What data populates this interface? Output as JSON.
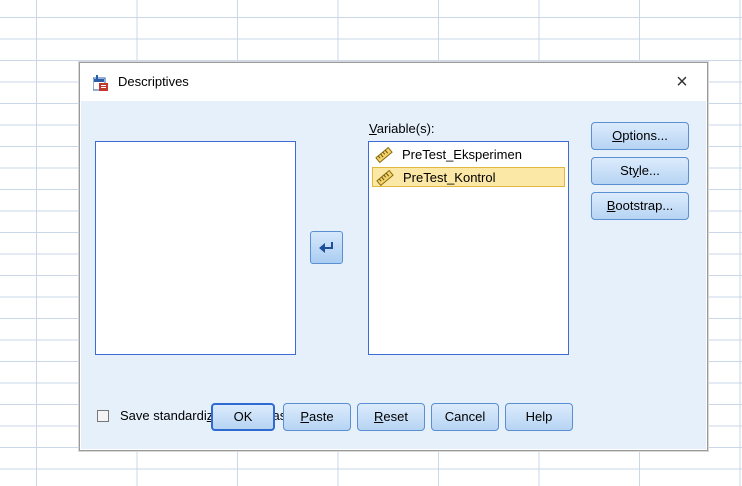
{
  "dialog": {
    "title": "Descriptives",
    "title_icon": "descriptives-app-icon",
    "close_glyph": "×"
  },
  "variables_label": {
    "pre": "",
    "ul": "V",
    "post": "ariable(s):"
  },
  "source_list": {
    "items": []
  },
  "target_list": {
    "items": [
      {
        "name": "PreTest_Eksperimen",
        "icon": "scale-ruler-icon",
        "selected": false
      },
      {
        "name": "PreTest_Kontrol",
        "icon": "scale-ruler-icon",
        "selected": true
      }
    ]
  },
  "side_buttons": {
    "options": {
      "pre": "",
      "ul": "O",
      "post": "ptions..."
    },
    "style": {
      "pre": "St",
      "ul": "y",
      "post": "le..."
    },
    "bootstrap": {
      "pre": "",
      "ul": "B",
      "post": "ootstrap..."
    }
  },
  "save_checkbox": {
    "checked": false,
    "pre": "Save standardi",
    "ul": "z",
    "post": "ed values as variables"
  },
  "bottom_buttons": {
    "ok": {
      "pre": "OK",
      "ul": "",
      "post": ""
    },
    "paste": {
      "pre": "",
      "ul": "P",
      "post": "aste"
    },
    "reset": {
      "pre": "",
      "ul": "R",
      "post": "eset"
    },
    "cancel": {
      "pre": "Cancel",
      "ul": "",
      "post": ""
    },
    "help": {
      "pre": "Help",
      "ul": "",
      "post": ""
    }
  },
  "colors": {
    "panel_bg": "#e5f0fb",
    "listbox_border": "#3c6cd4",
    "selection_bg": "#fbe7a6",
    "button_border": "#5a8fd2"
  }
}
